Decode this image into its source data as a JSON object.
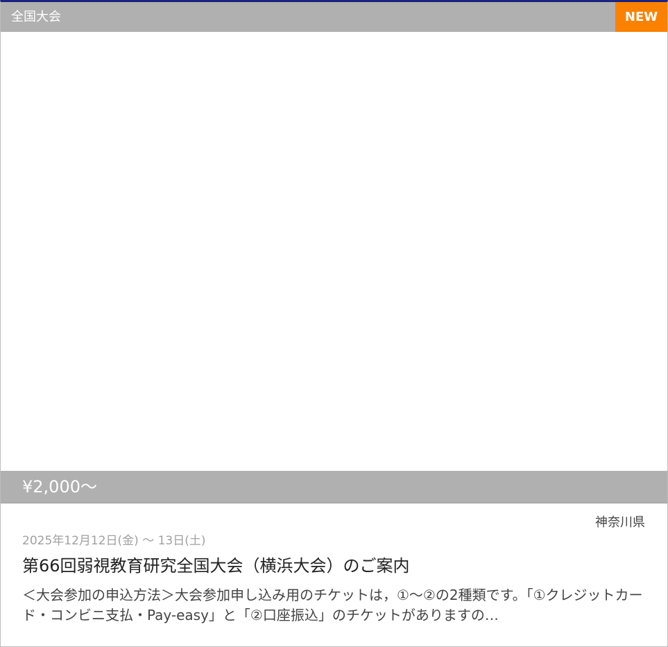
{
  "card": {
    "category": "全国大会",
    "badge": "NEW",
    "price": "¥2,000〜",
    "prefecture": "神奈川県",
    "date": "2025年12月12日(金) 〜 13日(土)",
    "title": "第66回弱視教育研究全国大会（横浜大会）のご案内",
    "description": "＜大会参加の申込方法＞大会参加申し込み用のチケットは，①〜②の2種類です。「①クレジットカード・コンビニ支払・Pay-easy」と「②口座振込」のチケットがありますの…"
  },
  "colors": {
    "top_border": "#1a237e",
    "category_bar": "#b0b0b0",
    "badge": "#fb8200",
    "price_bar": "#b0b0b0"
  }
}
